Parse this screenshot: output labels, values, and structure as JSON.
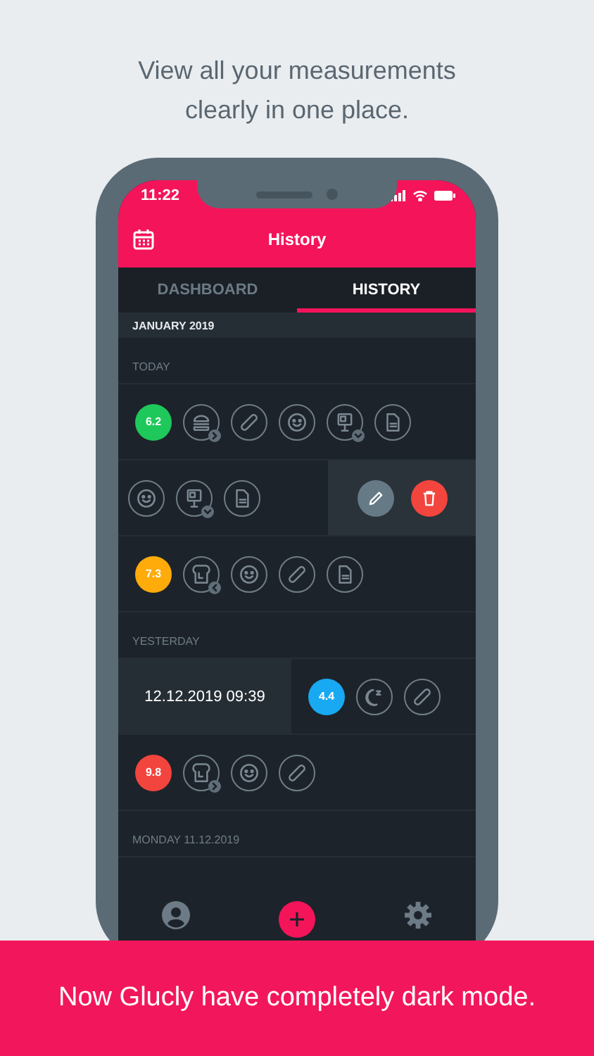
{
  "heading": "View all your measurements clearly in one place.",
  "status_bar": {
    "time": "11:22"
  },
  "app_bar": {
    "title": "History"
  },
  "tabs": [
    {
      "label": "DASHBOARD",
      "selected": false
    },
    {
      "label": "HISTORY",
      "selected": true
    }
  ],
  "month": "JANUARY 2019",
  "sections": [
    {
      "label": "TODAY",
      "entries": [
        {
          "value": "6.2",
          "color": "#1ec85a",
          "actions": false,
          "icons": [
            {
              "kind": "burger",
              "badge": {
                "kind": "right"
              }
            },
            {
              "kind": "bandage"
            },
            {
              "kind": "smiley"
            },
            {
              "kind": "scale",
              "badge": {
                "kind": "down"
              }
            },
            {
              "kind": "document"
            }
          ]
        },
        {
          "actions": true,
          "icons": [
            {
              "kind": "smiley"
            },
            {
              "kind": "scale",
              "badge": {
                "kind": "down"
              }
            },
            {
              "kind": "document"
            }
          ]
        },
        {
          "value": "7.3",
          "color": "#ffab0a",
          "actions": false,
          "icons": [
            {
              "kind": "toast",
              "badge": {
                "kind": "left"
              }
            },
            {
              "kind": "smiley"
            },
            {
              "kind": "bandage"
            },
            {
              "kind": "document"
            }
          ]
        }
      ]
    },
    {
      "label": "YESTERDAY",
      "entries": [
        {
          "date": "12.12.2019 09:39",
          "value": "4.4",
          "color": "#18a9f2",
          "actions": false,
          "icons": [
            {
              "kind": "moon"
            },
            {
              "kind": "bandage"
            }
          ]
        },
        {
          "value": "9.8",
          "color": "#f2453d",
          "actions": false,
          "icons": [
            {
              "kind": "toast",
              "badge": {
                "kind": "right"
              }
            },
            {
              "kind": "smiley"
            },
            {
              "kind": "bandage"
            }
          ]
        }
      ]
    },
    {
      "label": "MONDAY 11.12.2019"
    }
  ],
  "banner": "Now Glucly have completely dark mode."
}
